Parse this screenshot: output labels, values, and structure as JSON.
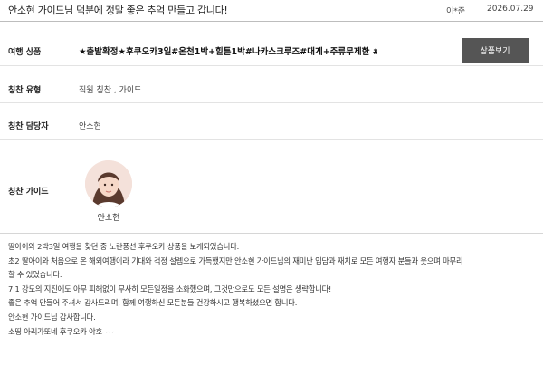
{
  "header": {
    "title": "안소현 가이드님 덕분에 정말 좋은 추억 만들고 갑니다!",
    "author": "이*준",
    "date": "2026.07.29"
  },
  "product": {
    "label": "여행 상품",
    "value": "★출발확정★후쿠오카3일#온천1박+힐튼1박#나카스크루즈#대게+주류무제한 #유...",
    "button_label": "상품보기"
  },
  "praise_type": {
    "label": "칭찬 유형",
    "value": "직원 칭찬 , 가이드"
  },
  "praise_manager": {
    "label": "칭찬 담당자",
    "value": "안소현"
  },
  "praise_guide": {
    "label": "칭찬 가이드",
    "name": "안소현"
  },
  "review": {
    "lines": [
      "딸아이와 2박3일 여행을 찾던 중 노란풍선 후쿠오카 상품을 보게되었습니다.",
      "초2 딸아이와 처음으로 온 해외여행이라 기대와 걱정 설렘으로 가득했지만 안소현 가이드님의 재미난 입담과 재치로 모든 여행자 분들과 웃으며 마무리",
      "할 수 있었습니다.",
      "7.1 강도의 지진에도 아무 피해없이 무사히 모든일정을 소화했으며, 그것만으로도 모든 설명은 생략합니다!",
      "좋은 추억 만들어 주셔서 감사드리며, 함께 여행하신 모든분들 건강하시고 행복하셨으면 합니다.",
      "안소현 가이드님 감사합니다.",
      "소띵 아리가또네 후쿠오카 야호~~"
    ]
  }
}
